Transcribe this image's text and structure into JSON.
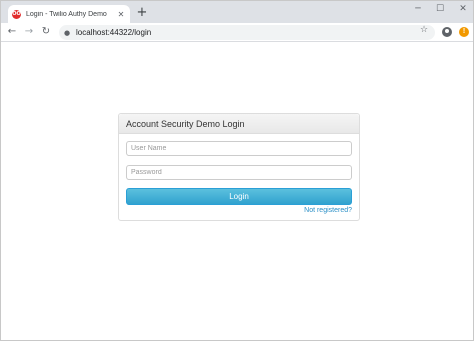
{
  "browser": {
    "tab": {
      "favicon_text": "OO",
      "title": "Login - Twilio Authy Demo",
      "close_glyph": "✕"
    },
    "new_tab_glyph": "+",
    "window_controls": {
      "minimize": "─",
      "maximize": "☐",
      "close": "✕"
    },
    "nav": {
      "back": "←",
      "forward": "→",
      "reload": "↻"
    },
    "lock_glyph": "🔒",
    "url": "localhost:44322/login",
    "star_glyph": "☆",
    "alert_glyph": "!"
  },
  "login_panel": {
    "heading": "Account Security Demo Login",
    "username_placeholder": "User Name",
    "password_placeholder": "Password",
    "login_label": "Login",
    "register_link": "Not registered?"
  },
  "colors": {
    "accent": "#5bc0de",
    "link": "#2a8fc6",
    "favicon": "#e12d2d",
    "alert": "#f29900"
  }
}
